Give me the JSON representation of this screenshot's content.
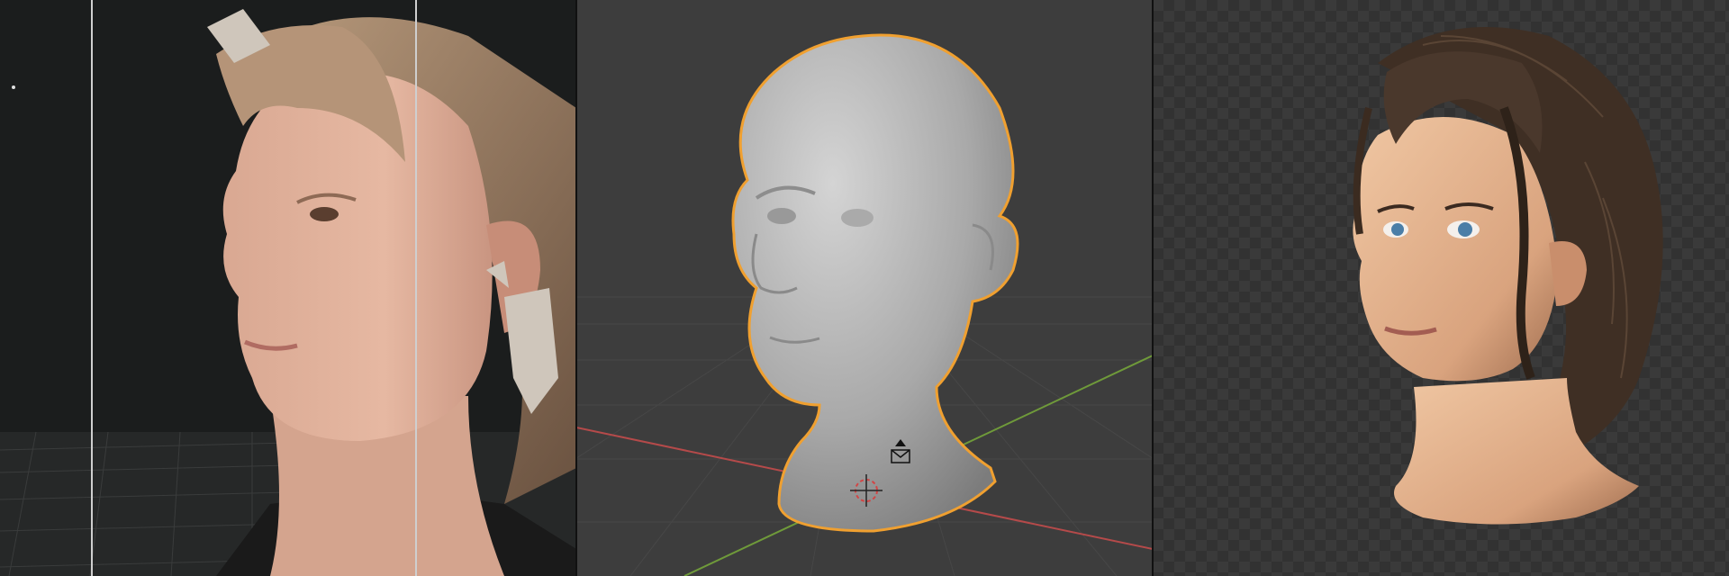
{
  "panels": [
    {
      "id": "photo",
      "caption": ""
    },
    {
      "id": "sculpt",
      "caption": ""
    },
    {
      "id": "render",
      "caption": ""
    }
  ],
  "colors": {
    "photo_bg": "#1b1d1d",
    "viewport_bg": "#3d3d3d",
    "selection_outline": "#f0a030",
    "axis_x": "#b54a4a",
    "axis_y": "#6f9a3a",
    "transparency_checker": [
      "#3a3a3a",
      "#323232"
    ]
  },
  "icons": [
    "3d-cursor-icon",
    "camera-object-icon"
  ]
}
